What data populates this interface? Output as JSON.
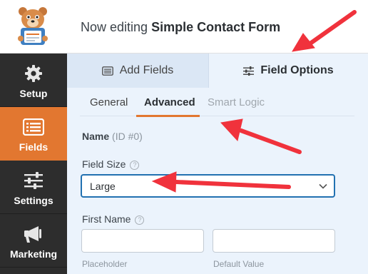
{
  "header": {
    "title_prefix": "Now editing ",
    "form_name": "Simple Contact Form"
  },
  "sidebar": {
    "items": [
      {
        "label": "Setup",
        "icon": "gear-icon"
      },
      {
        "label": "Fields",
        "icon": "list-icon",
        "active": true
      },
      {
        "label": "Settings",
        "icon": "sliders-icon"
      },
      {
        "label": "Marketing",
        "icon": "megaphone-icon"
      }
    ]
  },
  "panel": {
    "tabs": [
      {
        "label": "Add Fields",
        "icon": "list-icon"
      },
      {
        "label": "Field Options",
        "icon": "sliders-icon",
        "active": true
      }
    ],
    "subtabs": [
      {
        "label": "General"
      },
      {
        "label": "Advanced",
        "active": true
      },
      {
        "label": "Smart Logic",
        "disabled": true
      }
    ],
    "field_label": "Name",
    "field_id": "(ID #0)",
    "field_size_label": "Field Size",
    "field_size_value": "Large",
    "first_name_label": "First Name",
    "help_glyph": "?",
    "placeholder_sublabel": "Placeholder",
    "default_sublabel": "Default Value"
  },
  "colors": {
    "accent": "#e27730",
    "sidebar_bg": "#2d2d2d",
    "panel_bg": "#ebf3fc",
    "annotation_arrow": "#f0323c",
    "focus_border": "#2271b1"
  }
}
